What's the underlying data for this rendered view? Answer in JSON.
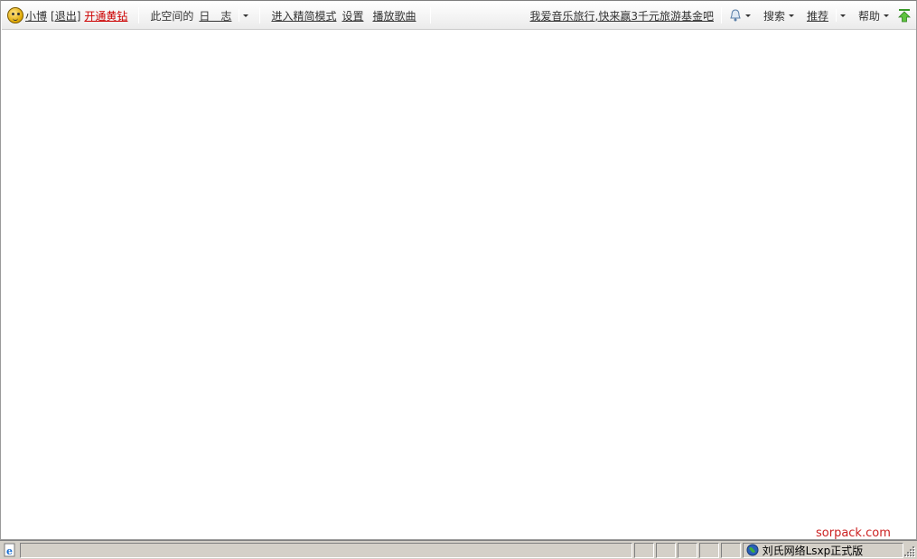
{
  "toolbar": {
    "username": "小博",
    "logout": "[退出]",
    "vip": "开通黄钻",
    "space_label": "此空间的",
    "space_section": "日　志",
    "simple_mode": "进入精简模式",
    "settings": "设置",
    "play_music": "播放歌曲",
    "promo": "我爱音乐旅行,快来赢3千元旅游基金吧",
    "search": "搜索",
    "recommend": "推荐",
    "help": "帮助"
  },
  "statusbar": {
    "zone_text": "刘氏网络Lsxp正式版"
  },
  "watermark": "sorpack.com",
  "colors": {
    "vip_red": "#cc0000",
    "statusbar_bg": "#d4d0c8"
  }
}
